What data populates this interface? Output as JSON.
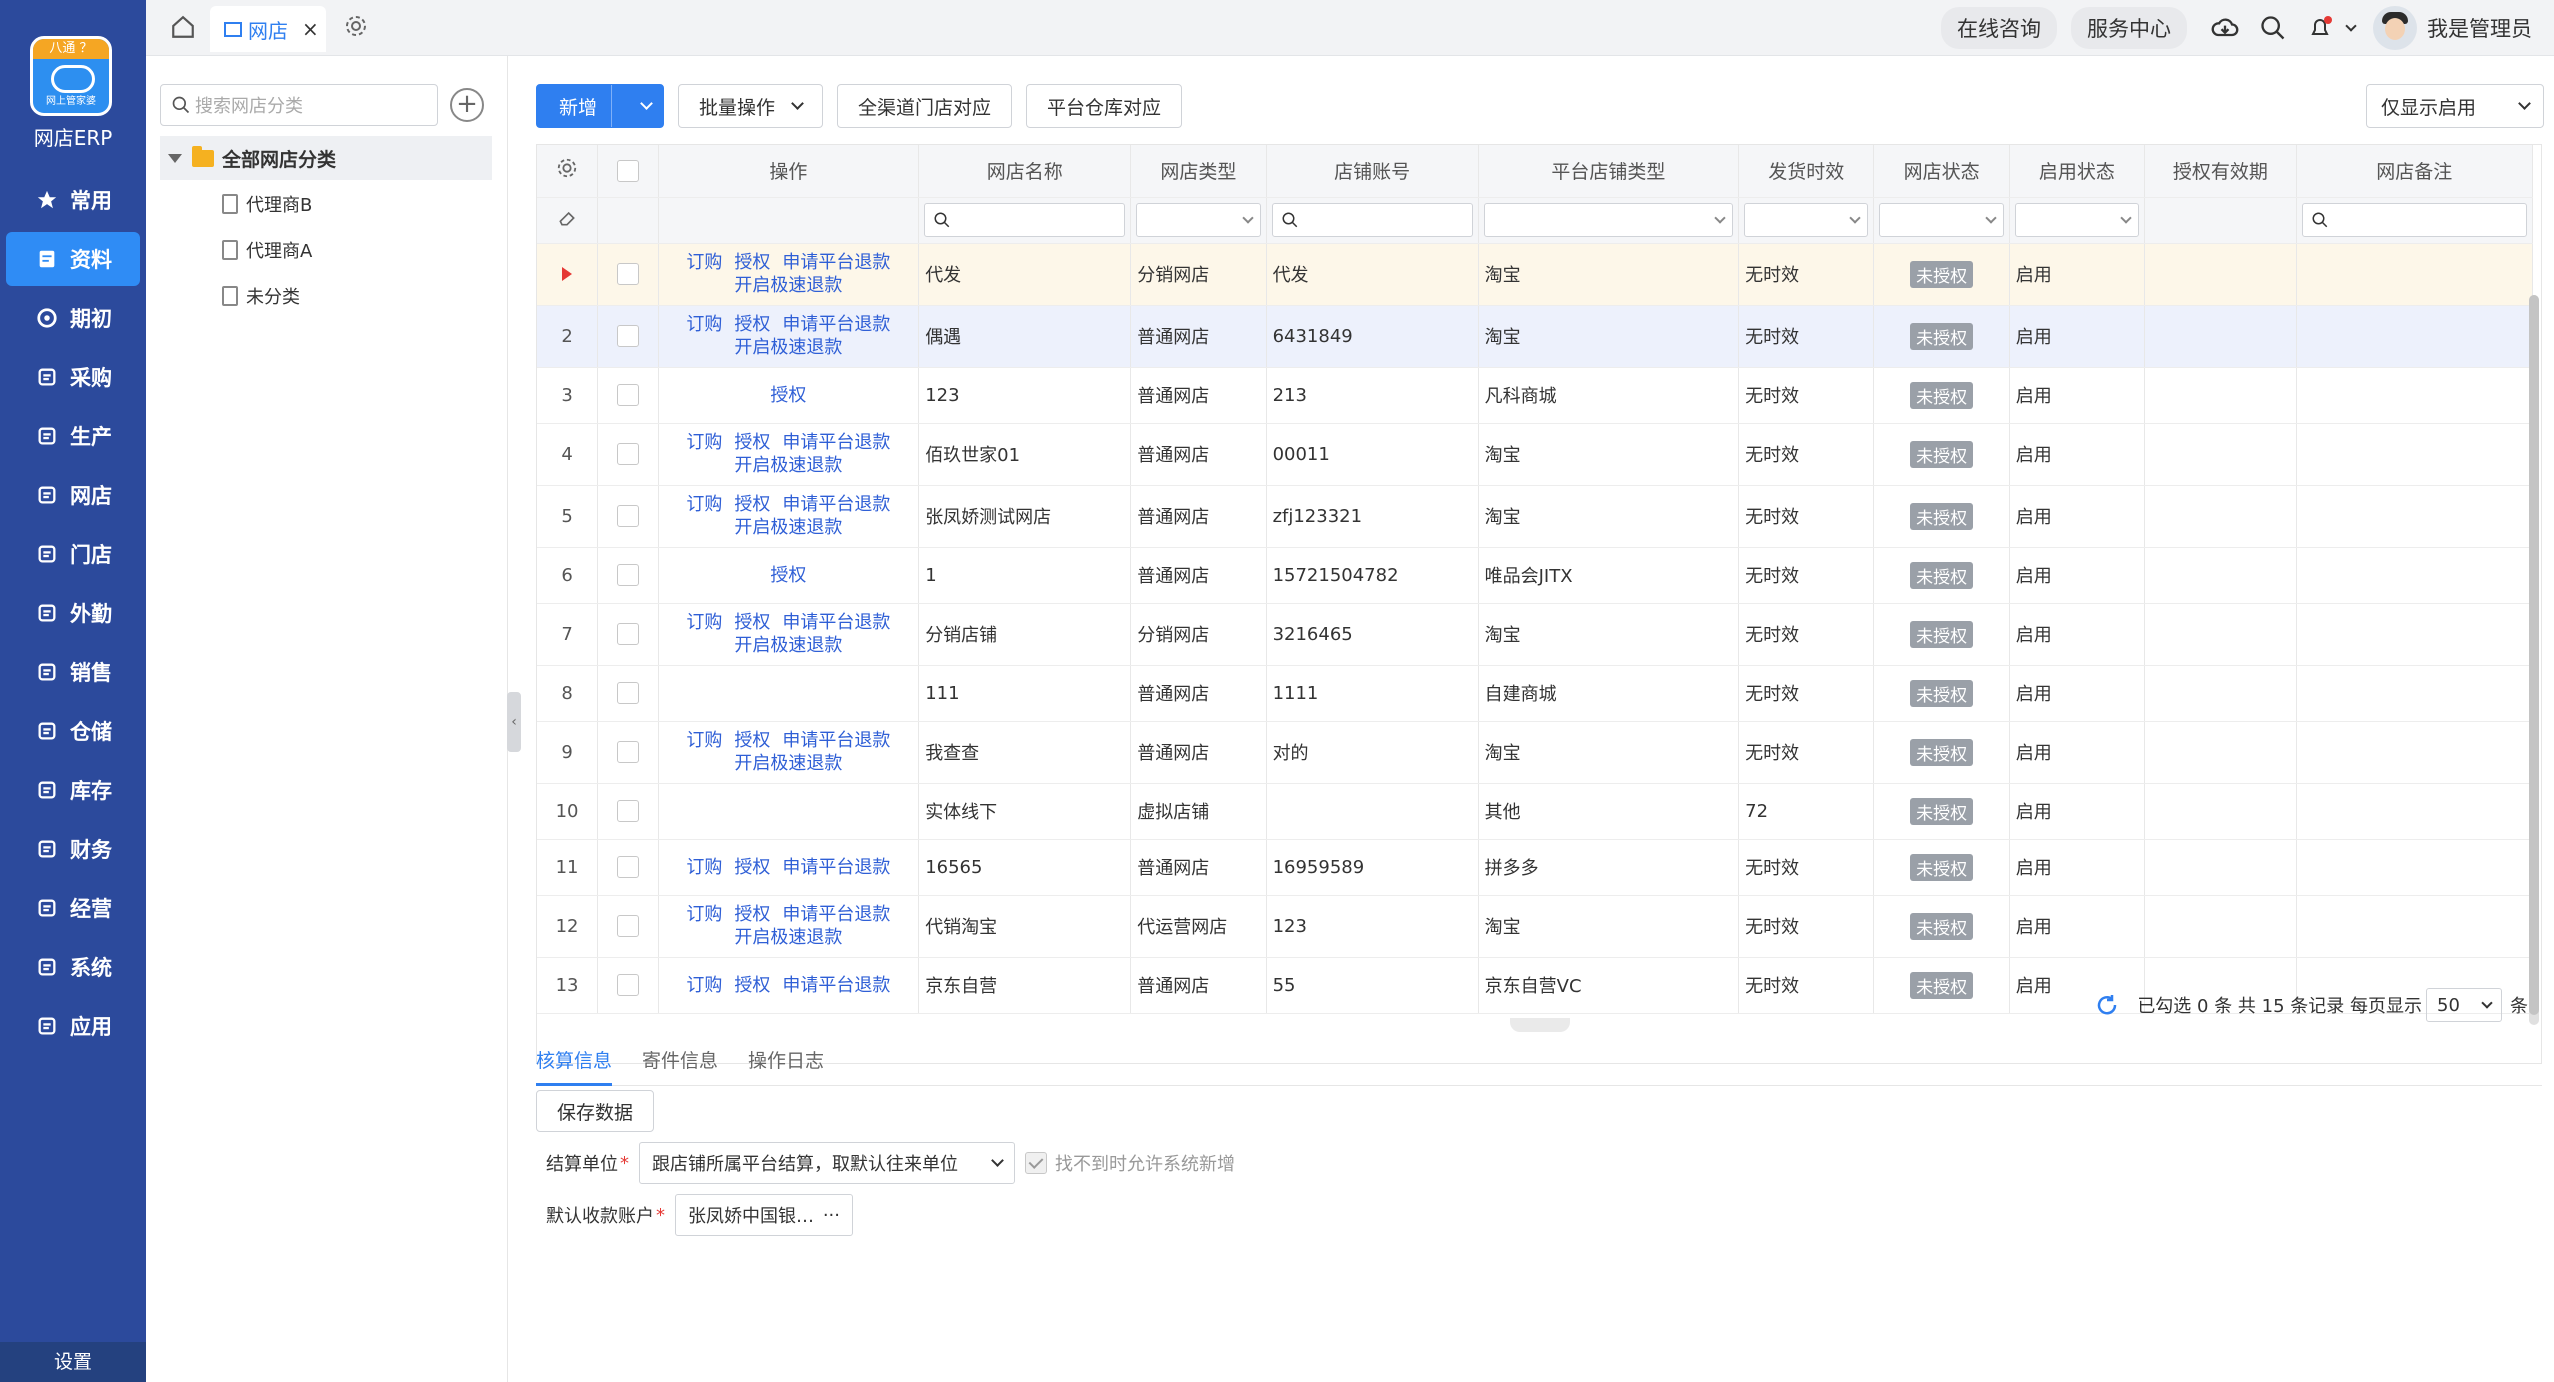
{
  "app": {
    "name": "网店ERP",
    "logo_top": "八通 ？",
    "logo_bottom": "网上管家婆"
  },
  "sidebar": {
    "items": [
      {
        "label": "常用",
        "icon": "star-icon"
      },
      {
        "label": "资料",
        "icon": "document-icon",
        "active": true
      },
      {
        "label": "期初",
        "icon": "circle-icon"
      },
      {
        "label": "采购",
        "icon": "purchase-icon"
      },
      {
        "label": "生产",
        "icon": "production-icon"
      },
      {
        "label": "网店",
        "icon": "shop-icon"
      },
      {
        "label": "门店",
        "icon": "pie-icon"
      },
      {
        "label": "外勤",
        "icon": "field-icon"
      },
      {
        "label": "销售",
        "icon": "sales-icon"
      },
      {
        "label": "仓储",
        "icon": "warehouse-icon"
      },
      {
        "label": "库存",
        "icon": "inventory-icon"
      },
      {
        "label": "财务",
        "icon": "finance-icon"
      },
      {
        "label": "经营",
        "icon": "business-icon"
      },
      {
        "label": "系统",
        "icon": "system-icon"
      },
      {
        "label": "应用",
        "icon": "apps-icon"
      }
    ],
    "footer": "设置"
  },
  "topbar": {
    "tab_label": "网店",
    "close": "×",
    "consult": "在线咨询",
    "service": "服务中心",
    "user": "我是管理员"
  },
  "tree": {
    "search_placeholder": "搜索网店分类",
    "add": "+",
    "root": "全部网店分类",
    "children": [
      "代理商B",
      "代理商A",
      "未分类"
    ]
  },
  "toolbar": {
    "new": "新增",
    "batch": "批量操作",
    "all_channel": "全渠道门店对应",
    "platform_wh": "平台仓库对应",
    "filter": "仅显示启用"
  },
  "table": {
    "headers": [
      "操作",
      "网店名称",
      "网店类型",
      "店铺账号",
      "平台店铺类型",
      "发货时效",
      "网店状态",
      "启用状态",
      "授权有效期",
      "网店备注"
    ],
    "rows": [
      {
        "no": "",
        "ops": [
          "订购",
          "授权",
          "申请平台退款",
          "开启极速退款"
        ],
        "name": "代发",
        "type": "分销网店",
        "account": "代发",
        "platform": "淘宝",
        "ship": "无时效",
        "status": "未授权",
        "enabled": "启用"
      },
      {
        "no": "2",
        "ops": [
          "订购",
          "授权",
          "申请平台退款",
          "开启极速退款"
        ],
        "name": "偶遇",
        "type": "普通网店",
        "account": "6431849",
        "platform": "淘宝",
        "ship": "无时效",
        "status": "未授权",
        "enabled": "启用"
      },
      {
        "no": "3",
        "ops": [
          "授权"
        ],
        "name": "123",
        "type": "普通网店",
        "account": "213",
        "platform": "凡科商城",
        "ship": "无时效",
        "status": "未授权",
        "enabled": "启用"
      },
      {
        "no": "4",
        "ops": [
          "订购",
          "授权",
          "申请平台退款",
          "开启极速退款"
        ],
        "name": "佰玖世家01",
        "type": "普通网店",
        "account": "00011",
        "platform": "淘宝",
        "ship": "无时效",
        "status": "未授权",
        "enabled": "启用"
      },
      {
        "no": "5",
        "ops": [
          "订购",
          "授权",
          "申请平台退款",
          "开启极速退款"
        ],
        "name": "张凤娇测试网店",
        "type": "普通网店",
        "account": "zfj123321",
        "platform": "淘宝",
        "ship": "无时效",
        "status": "未授权",
        "enabled": "启用"
      },
      {
        "no": "6",
        "ops": [
          "授权"
        ],
        "name": "1",
        "type": "普通网店",
        "account": "15721504782",
        "platform": "唯品会JITX",
        "ship": "无时效",
        "status": "未授权",
        "enabled": "启用"
      },
      {
        "no": "7",
        "ops": [
          "订购",
          "授权",
          "申请平台退款",
          "开启极速退款"
        ],
        "name": "分销店铺",
        "type": "分销网店",
        "account": "3216465",
        "platform": "淘宝",
        "ship": "无时效",
        "status": "未授权",
        "enabled": "启用"
      },
      {
        "no": "8",
        "ops": [],
        "name": "111",
        "type": "普通网店",
        "account": "1111",
        "platform": "自建商城",
        "ship": "无时效",
        "status": "未授权",
        "enabled": "启用"
      },
      {
        "no": "9",
        "ops": [
          "订购",
          "授权",
          "申请平台退款",
          "开启极速退款"
        ],
        "name": "我查查",
        "type": "普通网店",
        "account": "对的",
        "platform": "淘宝",
        "ship": "无时效",
        "status": "未授权",
        "enabled": "启用"
      },
      {
        "no": "10",
        "ops": [],
        "name": "实体线下",
        "type": "虚拟店铺",
        "account": "",
        "platform": "其他",
        "ship": "72",
        "status": "未授权",
        "enabled": "启用"
      },
      {
        "no": "11",
        "ops": [
          "订购",
          "授权",
          "申请平台退款"
        ],
        "name": "16565",
        "type": "普通网店",
        "account": "16959589",
        "platform": "拼多多",
        "ship": "无时效",
        "status": "未授权",
        "enabled": "启用"
      },
      {
        "no": "12",
        "ops": [
          "订购",
          "授权",
          "申请平台退款",
          "开启极速退款"
        ],
        "name": "代销淘宝",
        "type": "代运营网店",
        "account": "123",
        "platform": "淘宝",
        "ship": "无时效",
        "status": "未授权",
        "enabled": "启用"
      },
      {
        "no": "13",
        "ops": [
          "订购",
          "授权",
          "申请平台退款"
        ],
        "name": "京东自营",
        "type": "普通网店",
        "account": "55",
        "platform": "京东自营VC",
        "ship": "无时效",
        "status": "未授权",
        "enabled": "启用"
      }
    ]
  },
  "pager": {
    "summary": "已勾选 0 条  共 15 条记录  每页显示",
    "page_size": "50",
    "unit": "条"
  },
  "detail": {
    "tabs": [
      "核算信息",
      "寄件信息",
      "操作日志"
    ],
    "save": "保存数据",
    "unit_label": "结算单位",
    "unit_value": "跟店铺所属平台结算，取默认往来单位",
    "allow_new": "找不到时允许系统新增",
    "account_label": "默认收款账户",
    "account_value": "张凤娇中国银…",
    "more": "···"
  },
  "colors": {
    "sidebar": "#2c4a9c",
    "accent": "#2f7ff0",
    "link": "#2f5fd6",
    "badge": "#9aa0a8"
  }
}
